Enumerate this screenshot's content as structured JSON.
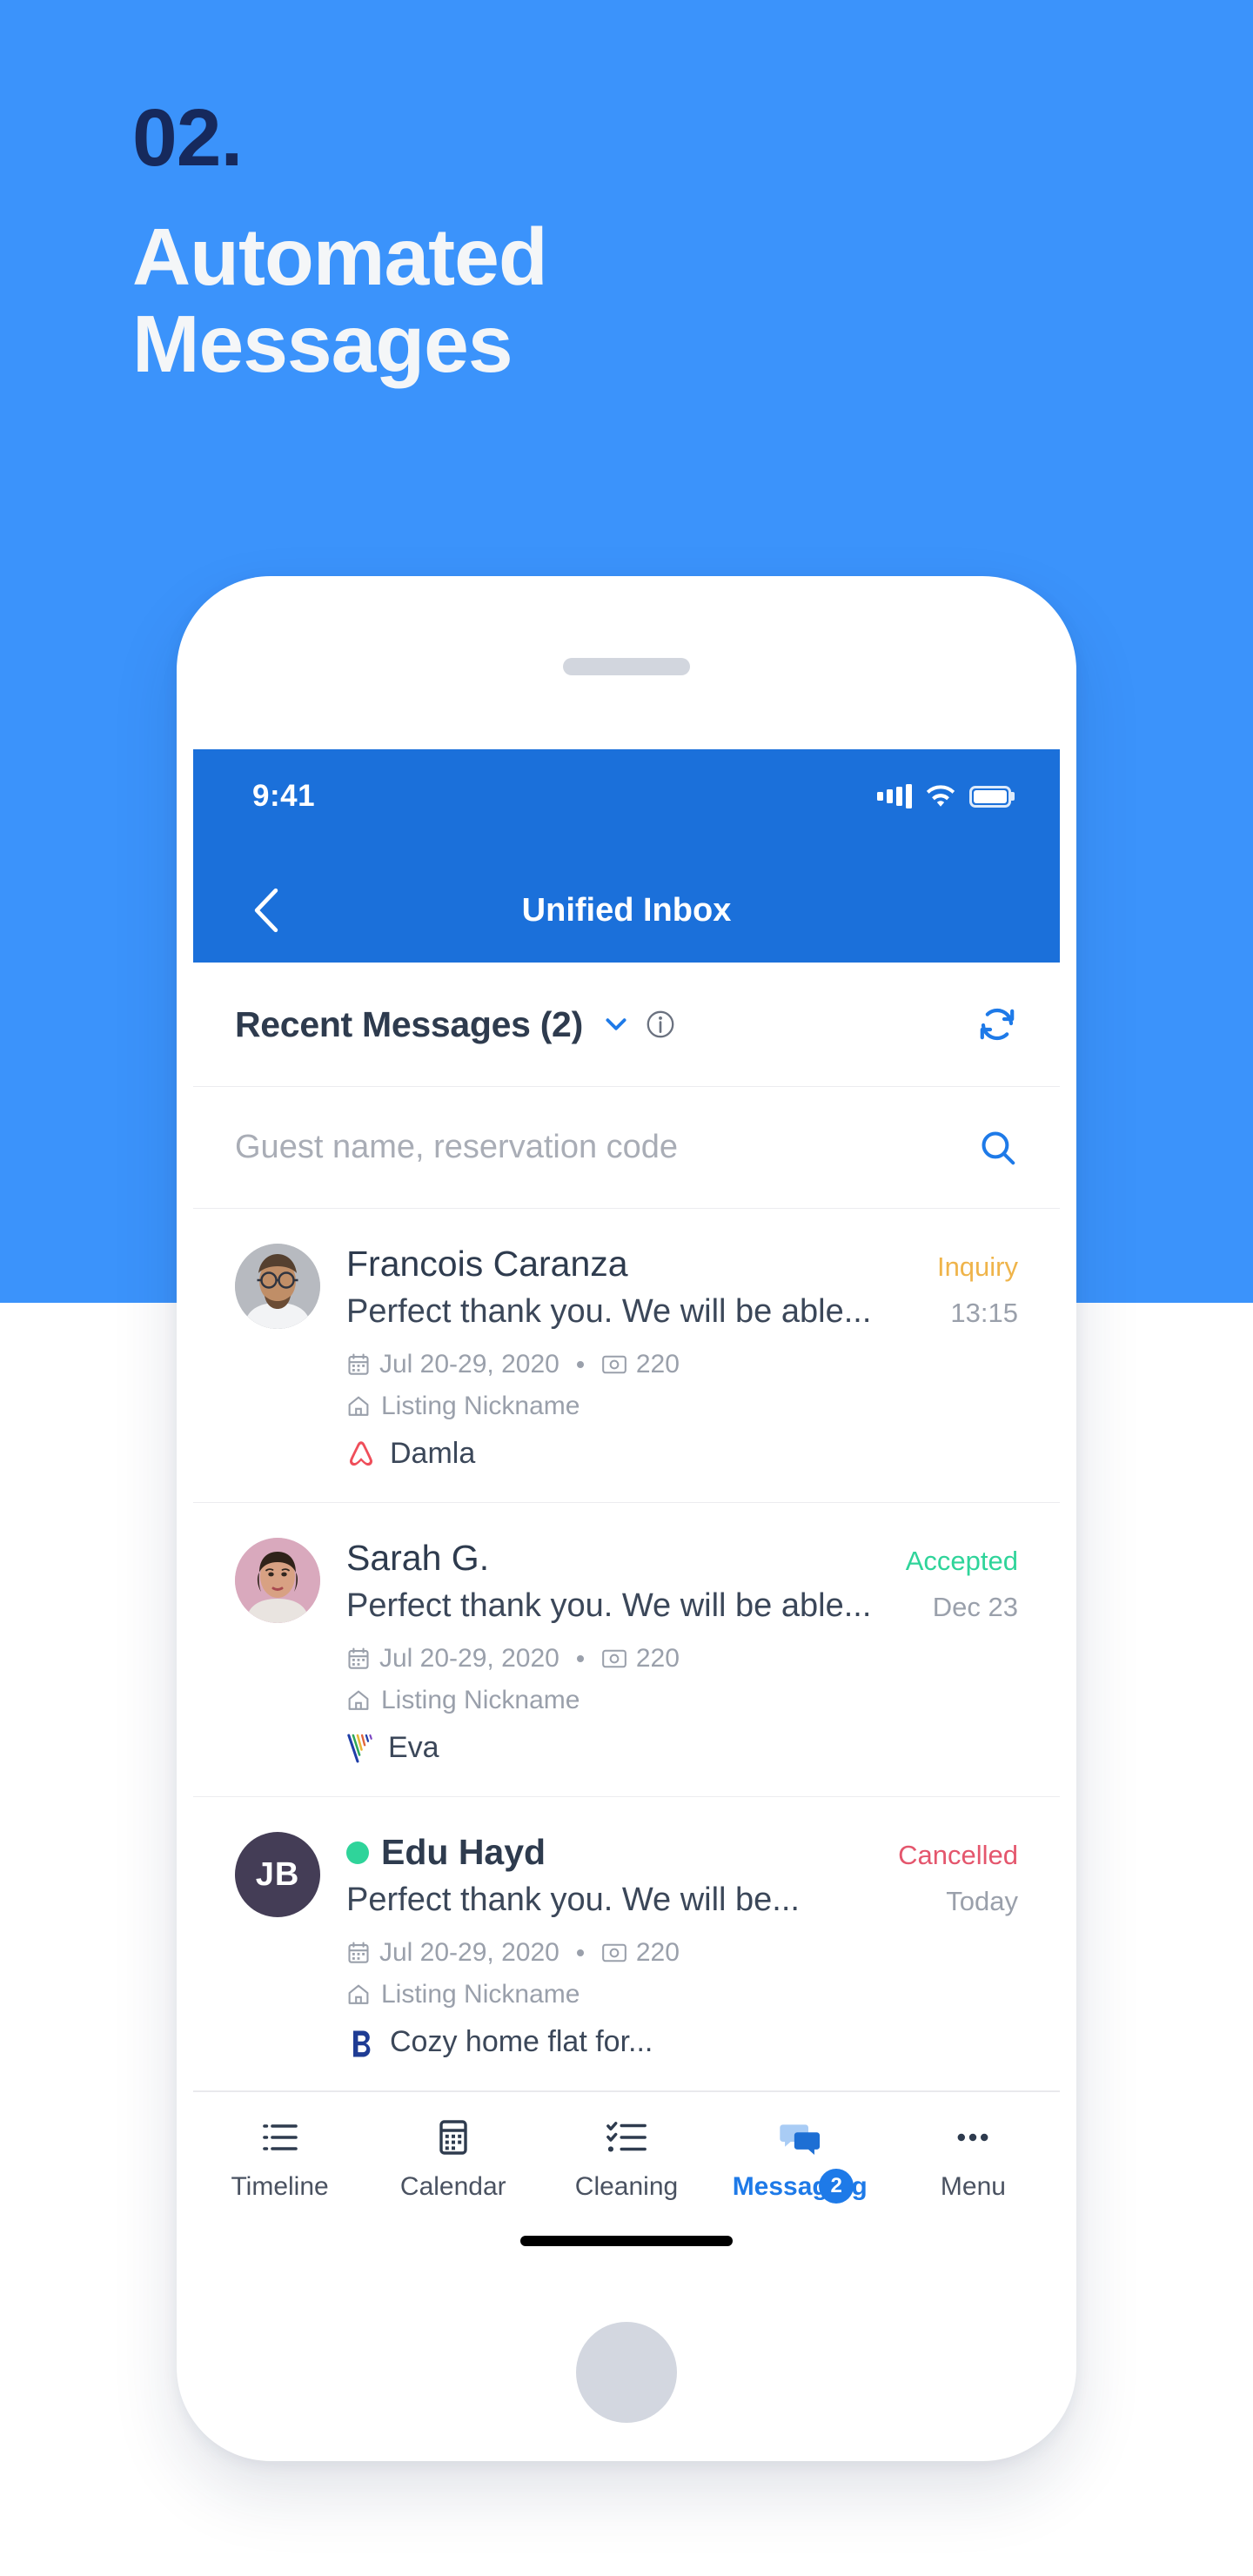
{
  "hero": {
    "number": "02.",
    "title_line1": "Automated",
    "title_line2": "Messages",
    "bg_color": "#3b93fb",
    "number_color": "#16295c",
    "title_color": "#f4f6f8"
  },
  "status_bar": {
    "time": "9:41",
    "signal_icon": "signal-bars-icon",
    "wifi_icon": "wifi-icon",
    "battery_icon": "battery-full-icon"
  },
  "nav": {
    "title": "Unified Inbox",
    "back_icon": "chevron-left-icon",
    "bar_color": "#1b70da"
  },
  "section": {
    "title": "Recent Messages (2)",
    "chevron_icon": "chevron-down-icon",
    "info_icon": "info-circle-icon",
    "refresh_icon": "refresh-icon",
    "accent_color": "#1e7ae8"
  },
  "search": {
    "value": "",
    "placeholder": "Guest name, reservation code",
    "search_icon": "search-icon"
  },
  "messages": [
    {
      "name": "Francois Caranza",
      "avatar_type": "photo",
      "avatar_bg": "#b9bcc1",
      "unread": false,
      "preview": "Perfect thank you. We will be able...",
      "status": "Inquiry",
      "status_color": "#efb44a",
      "time": "13:15",
      "dates": "Jul 20-29, 2020",
      "amount": "220",
      "listing": "Listing Nickname",
      "channel": "Damla",
      "channel_icon": "airbnb-icon"
    },
    {
      "name": "Sarah G.",
      "avatar_type": "photo",
      "avatar_bg": "#d8aabe",
      "unread": false,
      "preview": "Perfect thank you. We will be able...",
      "status": "Accepted",
      "status_color": "#2fd49a",
      "time": "Dec 23",
      "dates": "Jul 20-29, 2020",
      "amount": "220",
      "listing": "Listing Nickname",
      "channel": "Eva",
      "channel_icon": "vrbo-icon"
    },
    {
      "name": "Edu Hayd",
      "avatar_type": "initials",
      "avatar_initials": "JB",
      "avatar_bg": "#443d56",
      "unread": true,
      "preview": "Perfect thank you. We will be...",
      "status": "Cancelled",
      "status_color": "#e4566d",
      "time": "Today",
      "dates": "Jul 20-29, 2020",
      "amount": "220",
      "listing": "Listing Nickname",
      "channel": "Cozy home flat for...",
      "channel_icon": "booking-icon"
    }
  ],
  "meta_icons": {
    "calendar_icon": "calendar-icon",
    "money_icon": "money-icon",
    "house_icon": "house-icon"
  },
  "tabs": [
    {
      "label": "Timeline",
      "icon": "timeline-list-icon",
      "active": false,
      "badge": ""
    },
    {
      "label": "Calendar",
      "icon": "calendar-icon",
      "active": false,
      "badge": ""
    },
    {
      "label": "Cleaning",
      "icon": "checklist-icon",
      "active": false,
      "badge": ""
    },
    {
      "label": "Messaging",
      "icon": "chat-bubbles-icon",
      "active": true,
      "badge": "2"
    },
    {
      "label": "Menu",
      "icon": "ellipsis-icon",
      "active": false,
      "badge": ""
    }
  ]
}
